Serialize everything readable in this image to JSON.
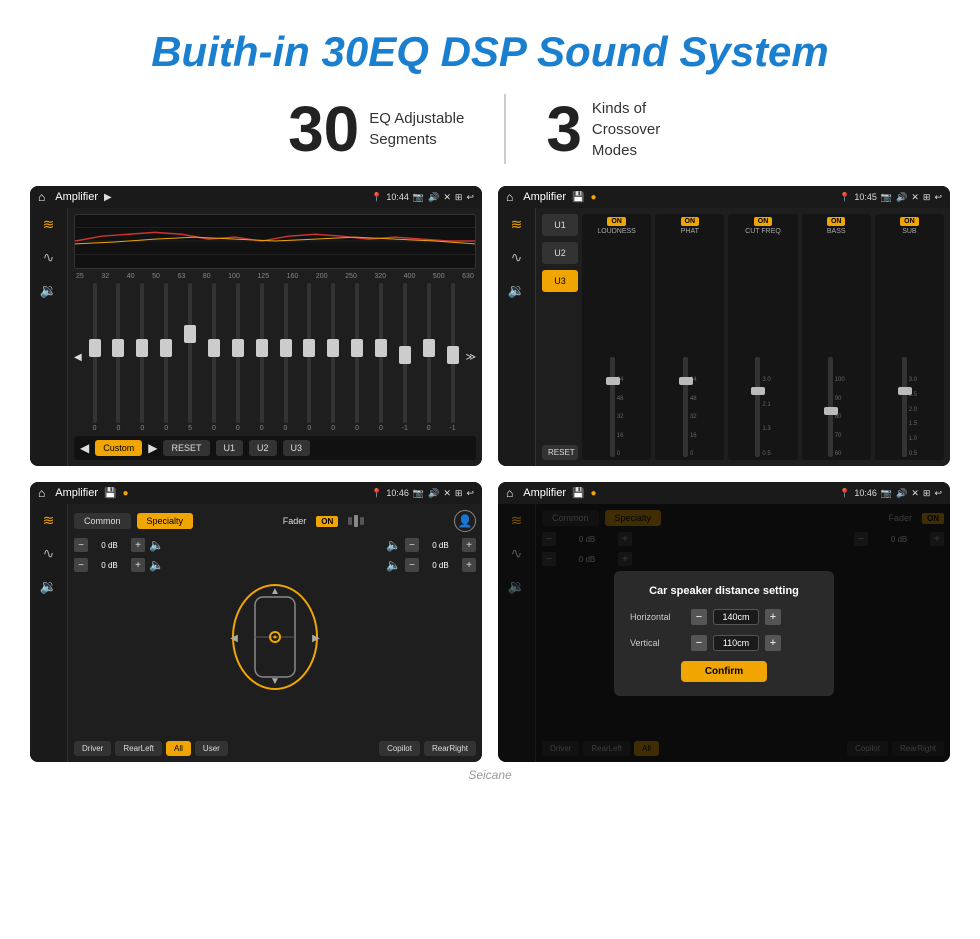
{
  "page": {
    "title": "Buith-in 30EQ DSP Sound System",
    "stat1_number": "30",
    "stat1_desc_line1": "EQ Adjustable",
    "stat1_desc_line2": "Segments",
    "stat2_number": "3",
    "stat2_desc_line1": "Kinds of",
    "stat2_desc_line2": "Crossover Modes",
    "watermark": "Seicane"
  },
  "screen1": {
    "title": "Amplifier",
    "time": "10:44",
    "freq_labels": [
      "25",
      "32",
      "40",
      "50",
      "63",
      "80",
      "100",
      "125",
      "160",
      "200",
      "250",
      "320",
      "400",
      "500",
      "630"
    ],
    "slider_vals": [
      "0",
      "0",
      "0",
      "0",
      "5",
      "0",
      "0",
      "0",
      "0",
      "0",
      "0",
      "0",
      "0",
      "-1",
      "0",
      "-1"
    ],
    "preset": "Custom",
    "buttons": [
      "RESET",
      "U1",
      "U2",
      "U3"
    ]
  },
  "screen2": {
    "title": "Amplifier",
    "time": "10:45",
    "presets": [
      "U1",
      "U2",
      "U3"
    ],
    "active_preset": "U3",
    "channels": [
      "LOUDNESS",
      "PHAT",
      "CUT FREQ",
      "BASS",
      "SUB"
    ],
    "channel_states": [
      "ON",
      "ON",
      "ON",
      "ON",
      "ON"
    ],
    "reset_label": "RESET"
  },
  "screen3": {
    "title": "Amplifier",
    "time": "10:46",
    "tabs": [
      "Common",
      "Specialty"
    ],
    "active_tab": "Specialty",
    "fader_label": "Fader",
    "fader_on": "ON",
    "db_rows": [
      {
        "label": "0 dB",
        "position": "top-left"
      },
      {
        "label": "0 dB",
        "position": "bottom-left"
      },
      {
        "label": "0 dB",
        "position": "top-right"
      },
      {
        "label": "0 dB",
        "position": "bottom-right"
      }
    ],
    "buttons": [
      "Driver",
      "RearLeft",
      "All",
      "User",
      "Copilot",
      "RearRight"
    ]
  },
  "screen4": {
    "title": "Amplifier",
    "time": "10:46",
    "tabs": [
      "Common",
      "Specialty"
    ],
    "active_tab": "Specialty",
    "dialog_title": "Car speaker distance setting",
    "horizontal_label": "Horizontal",
    "horizontal_value": "140cm",
    "vertical_label": "Vertical",
    "vertical_value": "110cm",
    "confirm_label": "Confirm",
    "db_rows": [
      {
        "label": "0 dB"
      },
      {
        "label": "0 dB"
      }
    ],
    "buttons": [
      "Driver",
      "RearLeft",
      "All",
      "Copilot",
      "RearRight"
    ]
  },
  "icons": {
    "home": "⌂",
    "play": "▶",
    "pause": "⏸",
    "location": "📍",
    "camera": "📷",
    "volume": "🔊",
    "close": "✕",
    "back": "↩",
    "settings": "⚙",
    "eq": "≋",
    "wave": "∿",
    "speaker": "🔉",
    "arrow_left": "◀",
    "arrow_right": "▶",
    "arrow_expand": "≫",
    "minus": "−",
    "plus": "+"
  }
}
